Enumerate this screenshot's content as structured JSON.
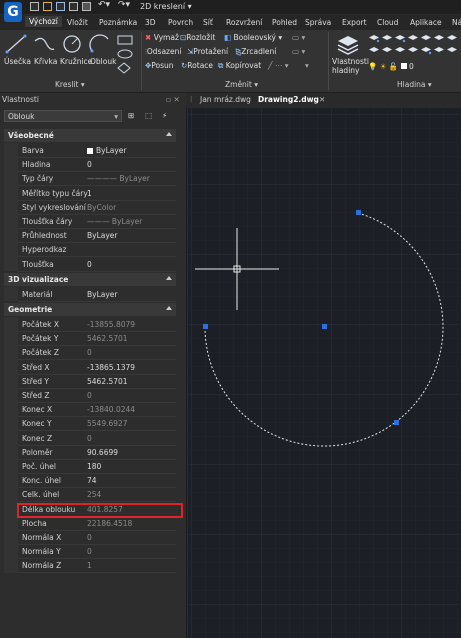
{
  "titlebar": {
    "workspace": "2D kreslení"
  },
  "menu_tabs": [
    "Výchozí",
    "Vložit",
    "Poznámka",
    "3D",
    "Povrch",
    "Síť",
    "Rozvržení",
    "Pohled",
    "Správa",
    "Export",
    "Cloud",
    "Aplikace",
    "Ná"
  ],
  "ribbon": {
    "draw_tools": [
      "Úsečka",
      "Křivka",
      "Kružnice",
      "Oblouk"
    ],
    "draw_group": "Kreslit",
    "modify_tools": {
      "row1": [
        "Vymaž",
        "Rozložit",
        "Booleovský"
      ],
      "row2": [
        "Odsazení",
        "Protažení",
        "Zrcadlení"
      ],
      "row3": [
        "Posun",
        "Rotace",
        "Kopírovat"
      ]
    },
    "modify_group": "Změnit",
    "layer_props": "Vlastnosti hladiny",
    "layer_value": "0",
    "layer_group": "Hladina"
  },
  "doc_tabs": [
    "Jan mráz.dwg",
    "Drawing2.dwg"
  ],
  "properties": {
    "title": "Vlastnosti",
    "selector": "Oblouk",
    "categories": [
      {
        "name": "Všeobecné",
        "rows": [
          {
            "k": "Barva",
            "v": "ByLayer"
          },
          {
            "k": "Hladina",
            "v": "0"
          },
          {
            "k": "Typ čáry",
            "v": "———— ByLayer"
          },
          {
            "k": "Měřítko typu čáry",
            "v": "1"
          },
          {
            "k": "Styl vykreslování",
            "v": "ByColor"
          },
          {
            "k": "Tloušťka čáry",
            "v": "——— ByLayer"
          },
          {
            "k": "Průhlednost",
            "v": "ByLayer"
          },
          {
            "k": "Hyperodkaz",
            "v": ""
          },
          {
            "k": "Tloušťka",
            "v": "0"
          }
        ]
      },
      {
        "name": "3D vizualizace",
        "rows": [
          {
            "k": "Materiál",
            "v": "ByLayer"
          }
        ]
      },
      {
        "name": "Geometrie",
        "rows": [
          {
            "k": "Počátek X",
            "v": "-13855.8079"
          },
          {
            "k": "Počátek Y",
            "v": "5462.5701"
          },
          {
            "k": "Počátek Z",
            "v": "0"
          },
          {
            "k": "Střed X",
            "v": "-13865.1379"
          },
          {
            "k": "Střed Y",
            "v": "5462.5701"
          },
          {
            "k": "Střed Z",
            "v": "0"
          },
          {
            "k": "Konec X",
            "v": "-13840.0244"
          },
          {
            "k": "Konec Y",
            "v": "5549.6927"
          },
          {
            "k": "Konec Z",
            "v": "0"
          },
          {
            "k": "Poloměr",
            "v": "90.6699"
          },
          {
            "k": "Poč. úhel",
            "v": "180"
          },
          {
            "k": "Konc. úhel",
            "v": "74"
          },
          {
            "k": "Celk. úhel",
            "v": "254"
          },
          {
            "k": "Délka oblouku",
            "v": "401.8257"
          },
          {
            "k": "Plocha",
            "v": "22186.4518"
          },
          {
            "k": "Normála X",
            "v": "0"
          },
          {
            "k": "Normála Y",
            "v": "0"
          },
          {
            "k": "Normála Z",
            "v": "1"
          }
        ]
      }
    ]
  }
}
